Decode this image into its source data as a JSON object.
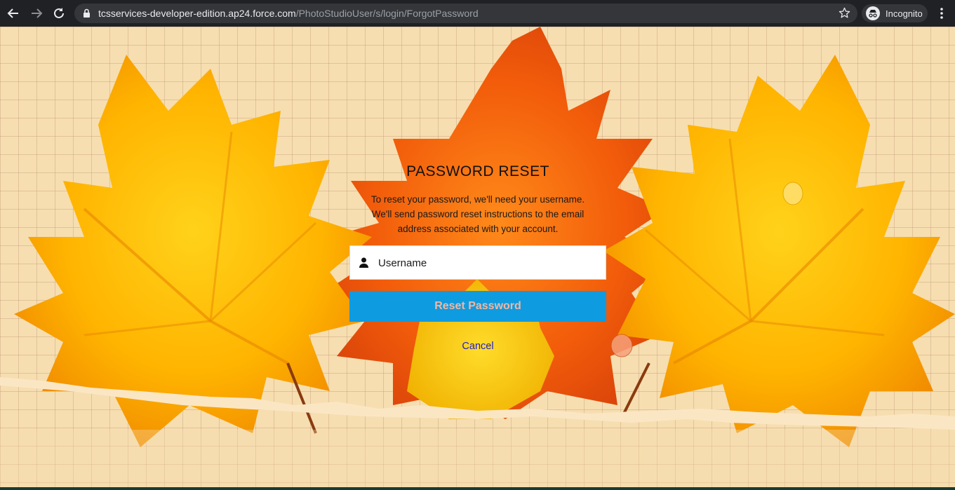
{
  "browser": {
    "url_domain": "tcsservices-developer-edition.ap24.force.com",
    "url_path": "/PhotoStudioUser/s/login/ForgotPassword",
    "incognito_label": "Incognito"
  },
  "form": {
    "title": "PASSWORD RESET",
    "description_lines": [
      "To reset your password, we'll need your username.",
      "We'll send password reset instructions to the email",
      "address associated with your account."
    ],
    "username_placeholder": "Username",
    "username_value": "",
    "reset_button_label": "Reset Password",
    "cancel_label": "Cancel"
  },
  "colors": {
    "button_bg": "#0f9be0",
    "button_text": "#f1b79f",
    "link": "#1e1ecf",
    "chrome_bg": "#202124"
  },
  "icons": [
    "back-arrow-icon",
    "forward-arrow-icon",
    "reload-icon",
    "lock-icon",
    "star-icon",
    "incognito-icon",
    "menu-icon",
    "user-icon"
  ]
}
